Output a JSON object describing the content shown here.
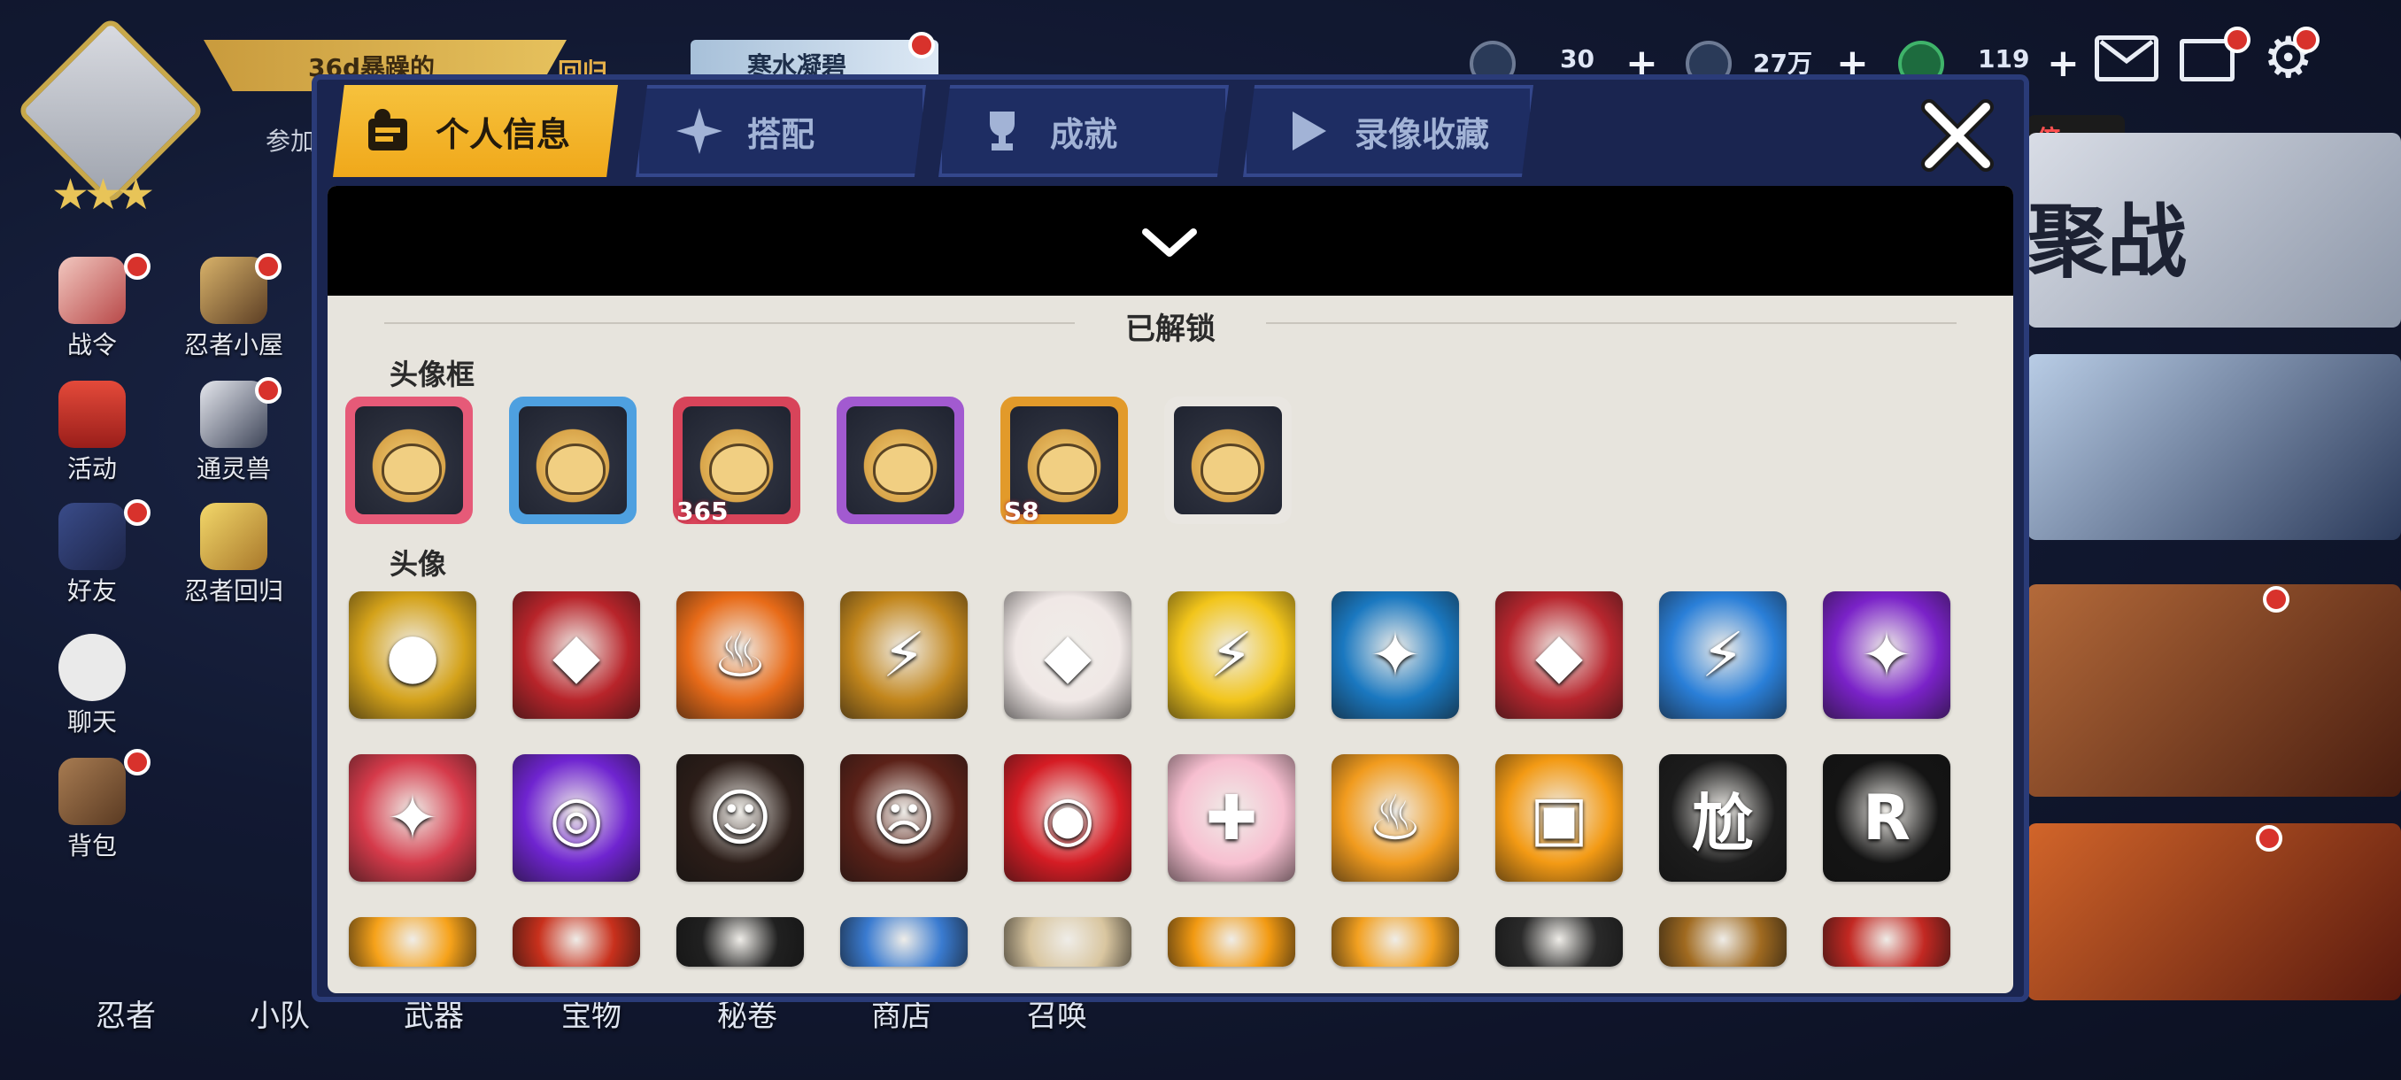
{
  "hud": {
    "banner_text": "36d暴躁的",
    "banner_sub": "参加",
    "banner2_text": "寒水凝碧",
    "banner_small": "回归",
    "resources": [
      {
        "icon": "shuriken-icon",
        "value": "30"
      },
      {
        "icon": "coin-icon",
        "value": "27万"
      },
      {
        "icon": "jade-icon",
        "value": "119"
      }
    ],
    "multiplier_badge": "倍",
    "right_card_title": "聚战"
  },
  "sidebar": {
    "items": [
      {
        "name": "sidebar-item-battle-pass",
        "label": "战令",
        "dot": true
      },
      {
        "name": "sidebar-item-ninja-house",
        "label": "忍者小屋",
        "dot": true
      },
      {
        "name": "sidebar-item-events",
        "label": "活动",
        "dot": false
      },
      {
        "name": "sidebar-item-spirit-beast",
        "label": "通灵兽",
        "dot": true
      },
      {
        "name": "sidebar-item-friends",
        "label": "好友",
        "dot": true
      },
      {
        "name": "sidebar-item-ninja-return",
        "label": "忍者回归",
        "dot": false
      },
      {
        "name": "sidebar-item-chat",
        "label": "聊天",
        "dot": false
      },
      {
        "name": "sidebar-item-bag",
        "label": "背包",
        "dot": true
      }
    ]
  },
  "bottom_nav": [
    "忍者",
    "小队",
    "武器",
    "宝物",
    "秘卷",
    "商店",
    "召唤"
  ],
  "modal": {
    "tabs": [
      {
        "label": "个人信息",
        "active": true
      },
      {
        "label": "搭配",
        "active": false
      },
      {
        "label": "成就",
        "active": false
      },
      {
        "label": "录像收藏",
        "active": false
      }
    ],
    "unlocked_title": "已解锁",
    "frames_title": "头像框",
    "avatars_title": "头像",
    "frame_badges": [
      "",
      "",
      "365",
      "",
      "S8",
      ""
    ],
    "frame_colors": [
      "#e65a78",
      "#4ea0e0",
      "#d8445a",
      "#a25ad0",
      "#e29a2a",
      "#e9e6e1"
    ],
    "avatar_rows": [
      [
        "#d4a21a",
        "#b8242a",
        "#e86b18",
        "#c2861c",
        "#f0e8e6",
        "#f2c51b",
        "#1a78c0",
        "#b8262e",
        "#2a7fd8",
        "#7a22c8"
      ],
      [
        "#d53a4a",
        "#6f24d0",
        "#2b1d18",
        "#5b2118",
        "#d51c24",
        "#f7bfd0",
        "#f19b1e",
        "#f39a14",
        "#1c1c1c",
        "#141414"
      ],
      [
        "#f6a21a",
        "#c8301c",
        "#202020",
        "#3a7bd0",
        "#d9c6a0",
        "#f29a12",
        "#f2a020",
        "#2a2a2a",
        "#a06a20",
        "#c22822"
      ]
    ],
    "avatar_glyphs": [
      [
        "●",
        "◆",
        "♨",
        "⚡",
        "◆",
        "⚡",
        "✦",
        "◆",
        "⚡",
        "✦"
      ],
      [
        "✦",
        "◎",
        "☺",
        "☹",
        "◉",
        "✚",
        "♨",
        "▣",
        "尬",
        "R"
      ],
      [
        "",
        "",
        "",
        "",
        "",
        "",
        "",
        "",
        "",
        ""
      ]
    ]
  }
}
